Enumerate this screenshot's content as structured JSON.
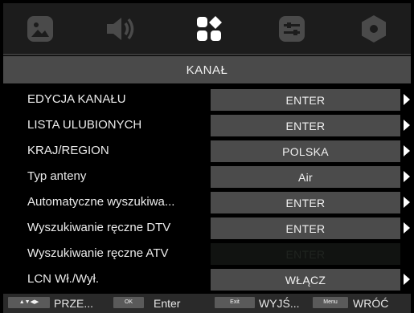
{
  "tabs": [
    {
      "icon": "picture-icon",
      "active": false
    },
    {
      "icon": "sound-icon",
      "active": false
    },
    {
      "icon": "channel-icon",
      "active": true
    },
    {
      "icon": "settings-icon",
      "active": false
    },
    {
      "icon": "lock-icon",
      "active": false
    }
  ],
  "header": {
    "title": "KANAŁ"
  },
  "menu": {
    "items": [
      {
        "label": "EDYCJA KANAŁU",
        "value": "ENTER",
        "enabled": true
      },
      {
        "label": "LISTA ULUBIONYCH",
        "value": "ENTER",
        "enabled": true
      },
      {
        "label": "KRAJ/REGION",
        "value": "POLSKA",
        "enabled": true
      },
      {
        "label": "Typ anteny",
        "value": "Air",
        "enabled": true
      },
      {
        "label": "Automatyczne wyszukiwa...",
        "value": "ENTER",
        "enabled": true
      },
      {
        "label": "Wyszukiwanie ręczne DTV",
        "value": "ENTER",
        "enabled": true
      },
      {
        "label": "Wyszukiwanie ręczne ATV",
        "value": "ENTER",
        "enabled": false
      },
      {
        "label": "LCN Wł./Wył.",
        "value": "WŁĄCZ",
        "enabled": true
      }
    ]
  },
  "footer": {
    "nav_key": "▲▼◀▶",
    "nav_label": "PRZE...",
    "ok_key": "OK",
    "ok_label": "Enter",
    "exit_key": "Exit",
    "exit_label": "WYJŚ...",
    "menu_key": "Menu",
    "menu_label": "WRÓĆ"
  },
  "colors": {
    "background": "#000000",
    "tab_bar": "#1c1c1c",
    "header": "#4a4a4a",
    "value_box": "#4b4b4b",
    "active_icon": "#ffffff",
    "inactive_icon": "#4a4a4a"
  }
}
